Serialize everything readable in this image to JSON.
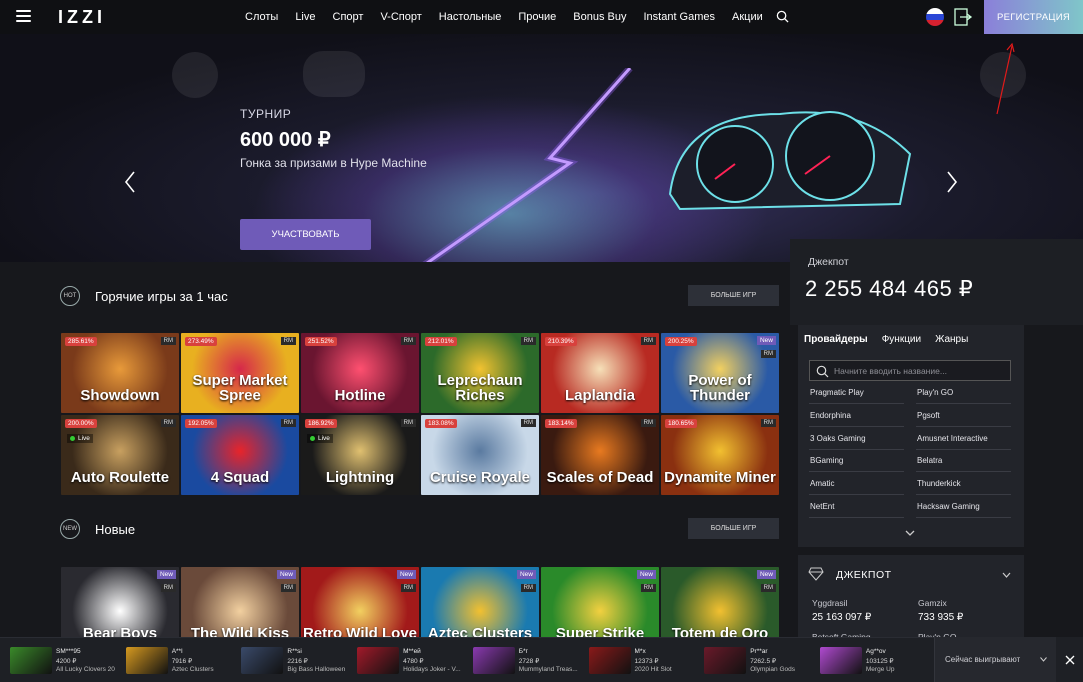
{
  "header": {
    "logo": "IZZI",
    "nav": [
      "Слоты",
      "Live",
      "Спорт",
      "V-Спорт",
      "Настольные",
      "Прочие",
      "Bonus Buy",
      "Instant Games",
      "Акции"
    ],
    "register": "РЕГИСТРАЦИЯ"
  },
  "hero": {
    "label": "ТУРНИР",
    "amount": "600 000 ₽",
    "subtitle": "Гонка за призами в Hype Machine",
    "button": "УЧАСТВОВАТЬ"
  },
  "hot": {
    "title": "Горячие игры за 1 час",
    "icon": "HOT",
    "more": "БОЛЬШЕ ИГР",
    "games": [
      {
        "title": "Showdown",
        "pct": "285.61%",
        "color": "#7a3a1a",
        "accent": "#e89a3a",
        "live": "",
        "rm": "RM"
      },
      {
        "title": "Super Market Spree",
        "pct": "273.49%",
        "color": "#e8b020",
        "accent": "#d6284a",
        "live": "",
        "rm": "RM"
      },
      {
        "title": "Hotline",
        "pct": "251.52%",
        "color": "#6a1530",
        "accent": "#ff5070",
        "live": "",
        "rm": "RM"
      },
      {
        "title": "Leprechaun Riches",
        "pct": "212.01%",
        "color": "#2c6a2a",
        "accent": "#f2c230",
        "live": "",
        "rm": "RM"
      },
      {
        "title": "Laplandia",
        "pct": "210.39%",
        "color": "#b82a22",
        "accent": "#f6e0b8",
        "live": "",
        "rm": "RM"
      },
      {
        "title": "Power of Thunder",
        "pct": "200.25%",
        "color": "#2a5aa6",
        "accent": "#f2d060",
        "live": "",
        "rm": "RM",
        "new": "New"
      },
      {
        "title": "Auto Roulette",
        "pct": "200.00%",
        "color": "#3a2a1a",
        "accent": "#c8a060",
        "live": "Live",
        "rm": "RM"
      },
      {
        "title": "4 Squad",
        "pct": "192.05%",
        "color": "#1a4aa0",
        "accent": "#e8242a",
        "live": "",
        "rm": "RM"
      },
      {
        "title": "Lightning",
        "pct": "186.92%",
        "color": "#1a1a1a",
        "accent": "#e0c070",
        "live": "Live",
        "rm": "RM"
      },
      {
        "title": "Cruise Royale",
        "pct": "183.08%",
        "color": "#c8d8e8",
        "accent": "#5a7aa0",
        "live": "",
        "rm": "RM"
      },
      {
        "title": "Scales of Dead",
        "pct": "183.14%",
        "color": "#3a1a10",
        "accent": "#e87a20",
        "live": "",
        "rm": "RM"
      },
      {
        "title": "Dynamite Miner",
        "pct": "180.65%",
        "color": "#8a3010",
        "accent": "#f2c030",
        "live": "",
        "rm": "RM"
      }
    ]
  },
  "newgames": {
    "title": "Новые",
    "icon": "NEW",
    "more": "БОЛЬШЕ ИГР",
    "games": [
      {
        "title": "Bear Boys",
        "color": "#2a2a30",
        "accent": "#ffffff",
        "new": "New",
        "rm": "RM"
      },
      {
        "title": "The Wild Kiss",
        "color": "#6a4a3a",
        "accent": "#f2d0a0",
        "new": "New",
        "rm": "RM"
      },
      {
        "title": "Retro Wild Love",
        "color": "#a21a1a",
        "accent": "#f2d060",
        "new": "New",
        "rm": "RM"
      },
      {
        "title": "Aztec Clusters",
        "color": "#1a7ab0",
        "accent": "#f2c030",
        "new": "New",
        "rm": "RM"
      },
      {
        "title": "Super Strike",
        "color": "#2a8a2a",
        "accent": "#f2d040",
        "new": "New",
        "rm": "RM"
      },
      {
        "title": "Totem de Oro",
        "color": "#2a5a2a",
        "accent": "#f2c030",
        "new": "New",
        "rm": "RM"
      }
    ]
  },
  "side": {
    "jackpot_label": "Джекпот",
    "jackpot_value": "2 255 484 465 ₽",
    "tabs": [
      "Провайдеры",
      "Функции",
      "Жанры"
    ],
    "search_placeholder": "Начните вводить название...",
    "providers": [
      [
        "Pragmatic Play",
        "Play'n GO"
      ],
      [
        "Endorphina",
        "Pgsoft"
      ],
      [
        "3 Oaks Gaming",
        "Amusnet Interactive"
      ],
      [
        "BGaming",
        "Belatra"
      ],
      [
        "Amatic",
        "Thunderkick"
      ],
      [
        "NetEnt",
        "Hacksaw Gaming"
      ]
    ],
    "jackpot2": {
      "title": "ДЖЕКПОТ",
      "items": [
        {
          "name": "Yggdrasil",
          "value": "25 163 097 ₽"
        },
        {
          "name": "Gamzix",
          "value": "733 935 ₽"
        },
        {
          "name": "Betsoft Gaming",
          "value": ""
        },
        {
          "name": "Play'n GO",
          "value": ""
        }
      ]
    }
  },
  "ticker": {
    "items": [
      {
        "user": "SM***95",
        "amount": "4200 ₽",
        "game": "All Lucky Clovers 20",
        "color": "#3a8a2a"
      },
      {
        "user": "А**l",
        "amount": "7916 ₽",
        "game": "Aztec Clusters",
        "color": "#d69a20"
      },
      {
        "user": "R**si",
        "amount": "2216 ₽",
        "game": "Big Bass Halloween",
        "color": "#3a4a6a"
      },
      {
        "user": "М**ей",
        "amount": "4780 ₽",
        "game": "Holidays Joker - V...",
        "color": "#a21a2a"
      },
      {
        "user": "Б*г",
        "amount": "2728 ₽",
        "game": "Mummyland Treas...",
        "color": "#8a3ab0"
      },
      {
        "user": "М*х",
        "amount": "12373 ₽",
        "game": "2020 Hit Slot",
        "color": "#8a1a1a"
      },
      {
        "user": "Pr**ar",
        "amount": "7262.5 ₽",
        "game": "Olympian Gods",
        "color": "#6a1a2a"
      },
      {
        "user": "Ag**ov",
        "amount": "103125 ₽",
        "game": "Merge Up",
        "color": "#b04ad0"
      }
    ],
    "now_label": "Сейчас выигрывают"
  }
}
